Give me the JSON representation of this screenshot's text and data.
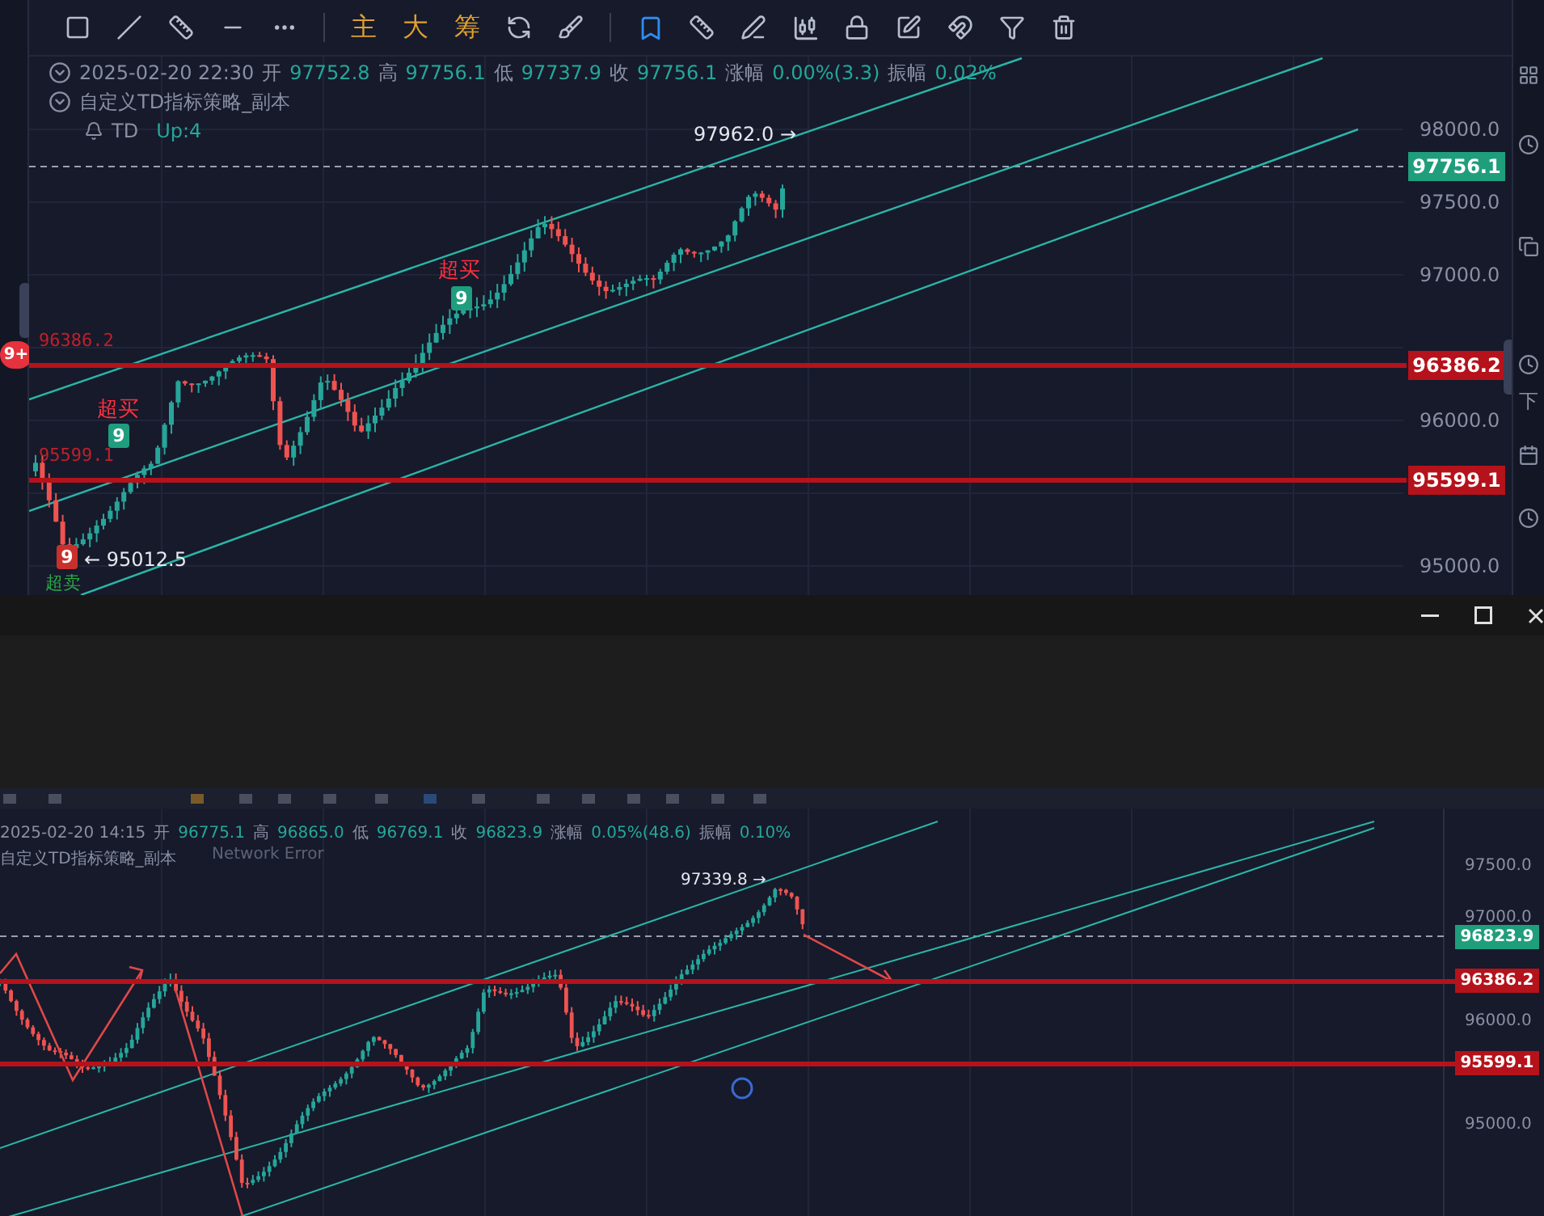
{
  "top_chart": {
    "toolbar": {
      "text_buttons": [
        "主",
        "大",
        "筹"
      ]
    },
    "bar_info": {
      "time": "2025-02-20 22:30",
      "fields": [
        {
          "label": "开",
          "value": "97752.8"
        },
        {
          "label": "高",
          "value": "97756.1"
        },
        {
          "label": "低",
          "value": "97737.9"
        },
        {
          "label": "收",
          "value": "97756.1"
        },
        {
          "label": "涨幅",
          "value": "0.00%(3.3)"
        },
        {
          "label": "振幅",
          "value": "0.02%"
        }
      ]
    },
    "indicator": "自定义TD指标策略_副本",
    "td": {
      "label": "TD",
      "status": "Up:4"
    },
    "price_axis": [
      "98000.0",
      "97500.0",
      "97000.0",
      "96000.0",
      "95000.0"
    ],
    "current_price": "97756.1",
    "levels": [
      {
        "label": "96386.2",
        "tag": "96386.2"
      },
      {
        "label": "95599.1",
        "tag": "95599.1"
      }
    ],
    "high_label": "97962.0 →",
    "low_label": "← 95012.5",
    "signals": [
      {
        "kind": "overbought",
        "text": "超买",
        "count": "9"
      },
      {
        "kind": "overbought",
        "text": "超买",
        "count": "9"
      },
      {
        "kind": "oversold",
        "text": "超卖",
        "count": "9"
      }
    ],
    "alert_badge": "9+",
    "sidebar_text": "下"
  },
  "bottom_chart": {
    "bar_info": {
      "time": "2025-02-20 14:15",
      "fields": [
        {
          "label": "开",
          "value": "96775.1"
        },
        {
          "label": "高",
          "value": "96865.0"
        },
        {
          "label": "低",
          "value": "96769.1"
        },
        {
          "label": "收",
          "value": "96823.9"
        },
        {
          "label": "涨幅",
          "value": "0.05%(48.6)"
        },
        {
          "label": "振幅",
          "value": "0.10%"
        }
      ]
    },
    "indicator": "自定义TD指标策略_副本",
    "status": "Network Error",
    "price_axis": [
      "97500.0",
      "97000.0",
      "96000.0",
      "95000.0"
    ],
    "current_price": "96823.9",
    "levels": [
      {
        "tag": "96386.2"
      },
      {
        "tag": "95599.1"
      }
    ],
    "high_label": "97339.8 →"
  }
}
